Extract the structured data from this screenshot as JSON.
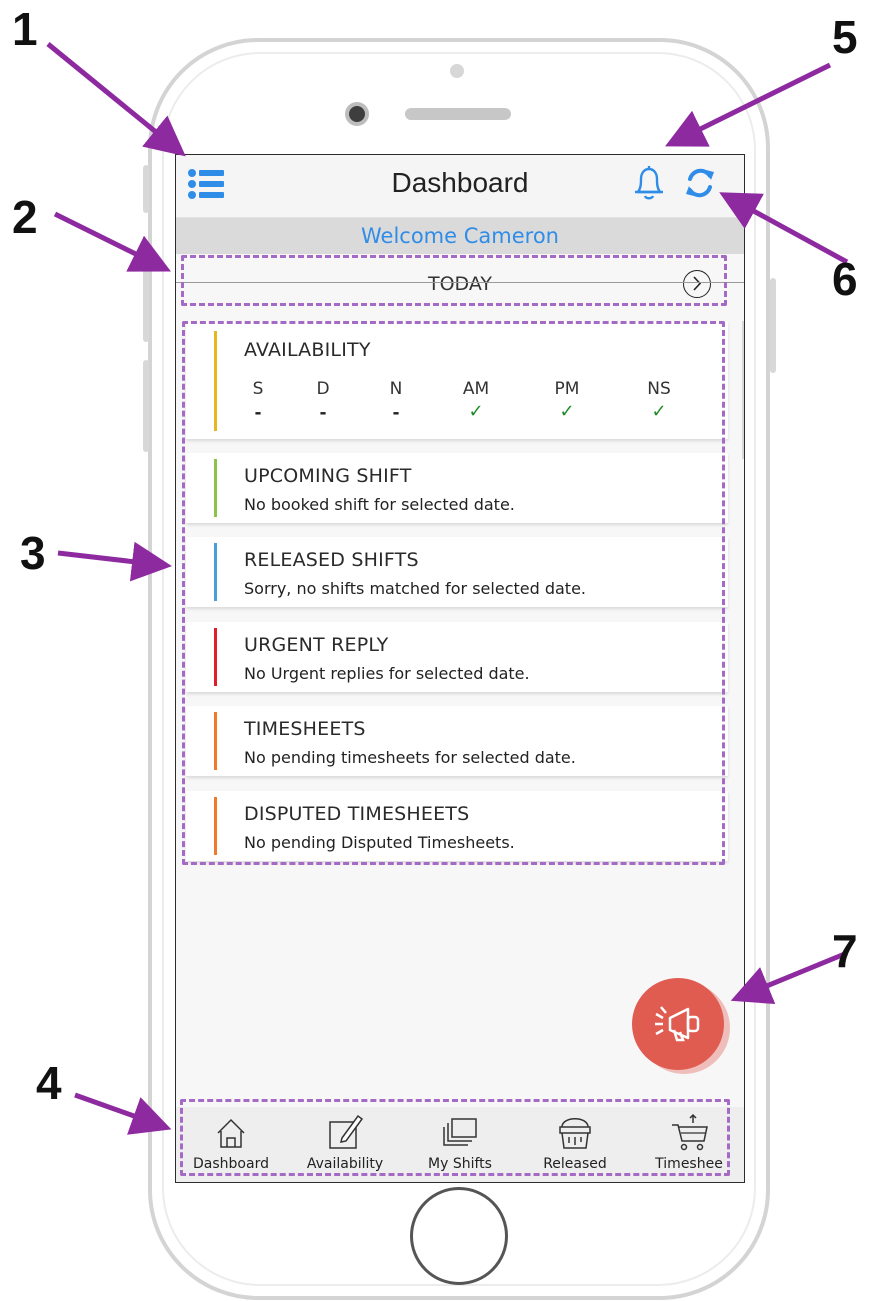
{
  "header": {
    "title": "Dashboard"
  },
  "welcome": "Welcome Cameron",
  "date_nav": {
    "label": "TODAY"
  },
  "availability": {
    "title": "AVAILABILITY",
    "columns": [
      {
        "label": "S",
        "value": "-"
      },
      {
        "label": "D",
        "value": "-"
      },
      {
        "label": "N",
        "value": "-"
      },
      {
        "label": "AM",
        "value": "✓"
      },
      {
        "label": "PM",
        "value": "✓"
      },
      {
        "label": "NS",
        "value": "✓"
      }
    ]
  },
  "cards": [
    {
      "title": "UPCOMING SHIFT",
      "text": "No booked shift for selected date.",
      "color": "#8bc34a"
    },
    {
      "title": "RELEASED SHIFTS",
      "text": "Sorry, no shifts matched for selected date.",
      "color": "#4a9fd8"
    },
    {
      "title": "URGENT REPLY",
      "text": "No Urgent replies for selected date.",
      "color": "#e01e2a"
    },
    {
      "title": "TIMESHEETS",
      "text": "No pending timesheets for selected date.",
      "color": "#f07a2a"
    },
    {
      "title": "DISPUTED TIMESHEETS",
      "text": "No pending Disputed Timesheets.",
      "color": "#f07a2a"
    }
  ],
  "availability_color": "#e6b820",
  "bottom_nav": [
    {
      "label": "Dashboard",
      "icon": "home-icon"
    },
    {
      "label": "Availability",
      "icon": "edit-icon"
    },
    {
      "label": "My Shifts",
      "icon": "stack-icon"
    },
    {
      "label": "Released",
      "icon": "bucket-icon"
    },
    {
      "label": "Timeshee",
      "icon": "cart-icon"
    }
  ],
  "callouts": [
    "1",
    "2",
    "3",
    "4",
    "5",
    "6",
    "7"
  ],
  "colors": {
    "accent": "#2f8de8",
    "annotation": "#8e2aa0",
    "fab": "#e05b50"
  }
}
